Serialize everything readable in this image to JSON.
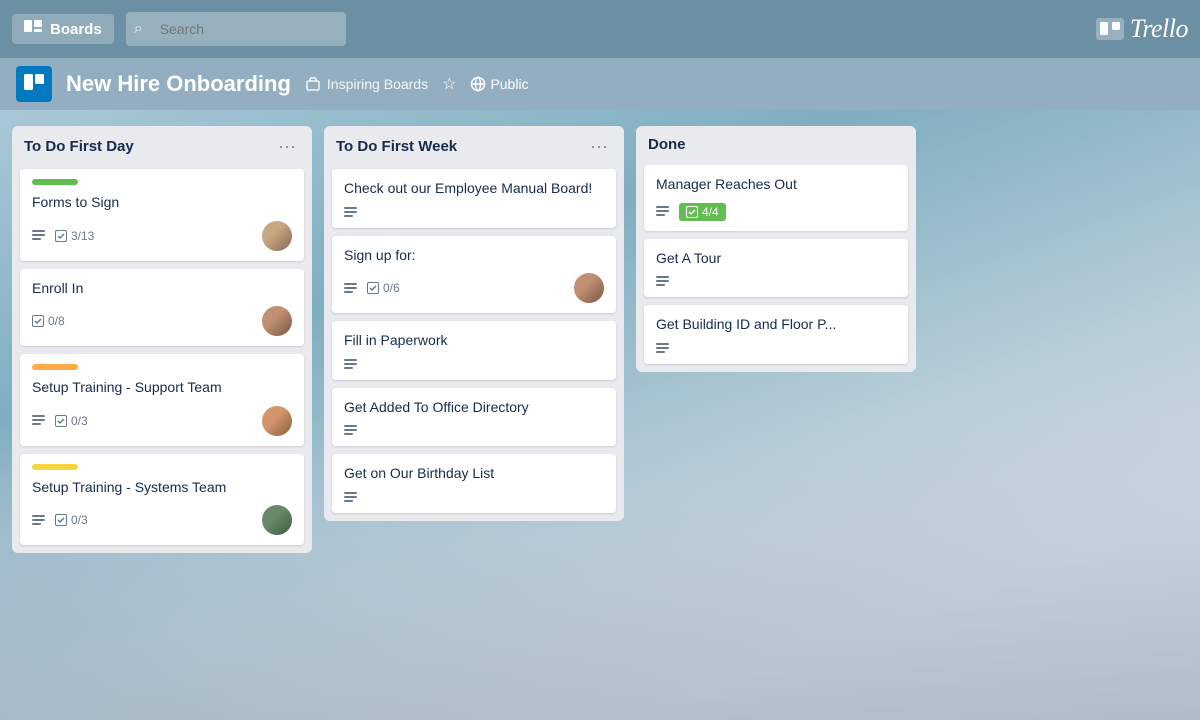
{
  "header": {
    "boards_label": "Boards",
    "search_placeholder": "Search",
    "logo_text": "Trello"
  },
  "board": {
    "title": "New Hire Onboarding",
    "inspiring_label": "Inspiring Boards",
    "visibility_label": "Public"
  },
  "columns": [
    {
      "id": "col-1",
      "title": "To Do First Day",
      "cards": [
        {
          "id": "card-1",
          "label_color": "#61bd4f",
          "title": "Forms to Sign",
          "has_desc": true,
          "checklist": "3/13",
          "checklist_complete": false,
          "has_avatar": true,
          "avatar_class": "avatar-1"
        },
        {
          "id": "card-2",
          "title": "Enroll In",
          "has_desc": false,
          "checklist": "0/8",
          "checklist_complete": false,
          "has_avatar": true,
          "avatar_class": "avatar-2"
        },
        {
          "id": "card-3",
          "label_color": "#ffab4a",
          "title": "Setup Training - Support Team",
          "has_desc": true,
          "checklist": "0/3",
          "checklist_complete": false,
          "has_avatar": true,
          "avatar_class": "avatar-3"
        },
        {
          "id": "card-4",
          "label_color": "#f5d63d",
          "title": "Setup Training - Systems Team",
          "has_desc": true,
          "checklist": "0/3",
          "checklist_complete": false,
          "has_avatar": true,
          "avatar_class": "avatar-4"
        }
      ]
    },
    {
      "id": "col-2",
      "title": "To Do First Week",
      "cards": [
        {
          "id": "card-5",
          "title": "Check out our Employee Manual Board!",
          "has_desc": true,
          "checklist": null,
          "has_avatar": false
        },
        {
          "id": "card-6",
          "title": "Sign up for:",
          "has_desc": true,
          "checklist": "0/6",
          "checklist_complete": false,
          "has_avatar": true,
          "avatar_class": "avatar-2"
        },
        {
          "id": "card-7",
          "title": "Fill in Paperwork",
          "has_desc": true,
          "checklist": null,
          "has_avatar": false
        },
        {
          "id": "card-8",
          "title": "Get Added To Office Directory",
          "has_desc": true,
          "checklist": null,
          "has_avatar": false
        },
        {
          "id": "card-9",
          "title": "Get on Our Birthday List",
          "has_desc": true,
          "checklist": null,
          "has_avatar": false
        }
      ]
    },
    {
      "id": "col-3",
      "title": "Done",
      "cards": [
        {
          "id": "card-10",
          "title": "Manager Reaches Out",
          "has_desc": true,
          "checklist": "4/4",
          "checklist_complete": true,
          "has_avatar": false
        },
        {
          "id": "card-11",
          "title": "Get A Tour",
          "has_desc": true,
          "checklist": null,
          "has_avatar": false
        },
        {
          "id": "card-12",
          "title": "Get Building ID and Floor P...",
          "has_desc": true,
          "checklist": null,
          "has_avatar": false
        }
      ]
    }
  ]
}
